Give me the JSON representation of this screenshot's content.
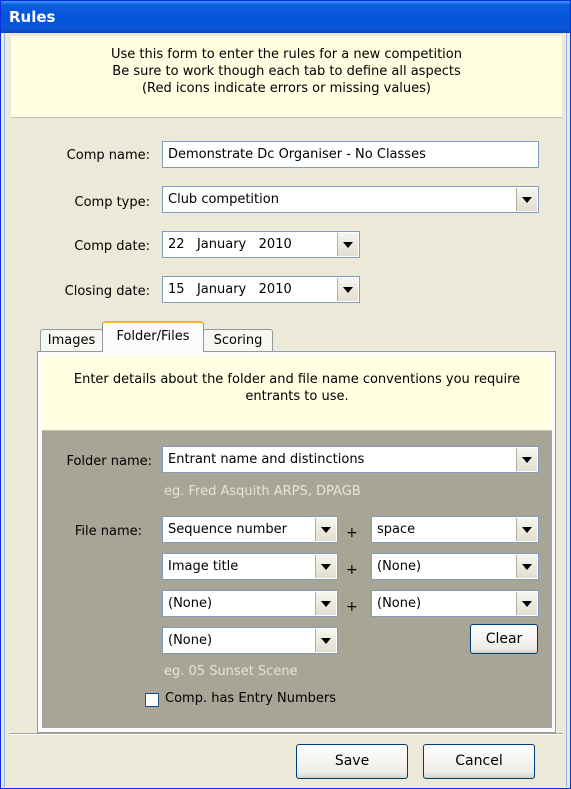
{
  "window": {
    "title": "Rules"
  },
  "info": {
    "line1": "Use this form to enter the rules for a new competition",
    "line2": "Be sure to work though each tab to define all aspects",
    "line3": "(Red icons indicate errors or missing values)"
  },
  "fields": {
    "comp_name": {
      "label": "Comp name:",
      "value": "Demonstrate Dc Organiser - No Classes"
    },
    "comp_type": {
      "label": "Comp type:",
      "value": "Club competition"
    },
    "comp_date": {
      "label": "Comp date:",
      "day": "22",
      "month": "January",
      "year": "2010"
    },
    "closing_date": {
      "label": "Closing date:",
      "day": "15",
      "month": "January",
      "year": "2010"
    }
  },
  "tabs": [
    {
      "label": "Images",
      "active": false
    },
    {
      "label": "Folder/Files",
      "active": true
    },
    {
      "label": "Scoring",
      "active": false
    }
  ],
  "panel": {
    "info_line1": "Enter details about the folder and file name conventions you require",
    "info_line2": "entrants to use.",
    "folder_name": {
      "label": "Folder name:",
      "value": "Entrant name and distinctions",
      "example": "eg. Fred Asquith ARPS, DPAGB"
    },
    "file_name": {
      "label": "File name:",
      "rows": [
        {
          "left": "Sequence number",
          "right": "space"
        },
        {
          "left": "Image title",
          "right": "(None)"
        },
        {
          "left": "(None)",
          "right": "(None)"
        }
      ],
      "last": "(None)",
      "plus": "+",
      "clear_label": "Clear",
      "example": "eg. 05 Sunset Scene"
    },
    "entry_numbers": {
      "label": "Comp. has Entry Numbers",
      "checked": false
    }
  },
  "buttons": {
    "save": "Save",
    "cancel": "Cancel"
  }
}
